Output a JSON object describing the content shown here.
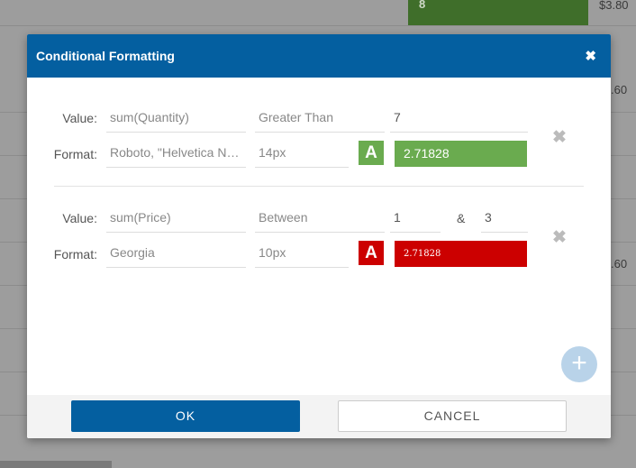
{
  "background": {
    "cell_value": "8",
    "price_1": "$3.80",
    "price_2": ".60",
    "price_3": ".60",
    "accent": "#3f6e2a"
  },
  "dialog": {
    "title": "Conditional Formatting",
    "close_icon": "close-icon",
    "header_color": "#045fa0"
  },
  "rules": [
    {
      "value_label": "Value:",
      "format_label": "Format:",
      "expression": "sum(Quantity)",
      "operator": "Greater Than",
      "value1": "7",
      "font": "Roboto, \"Helvetica Neue\", Helvetica, Arial, sans-serif",
      "size": "14px",
      "a_icon": "A",
      "preview_text": "2.71828",
      "color": "#6aab4f"
    },
    {
      "value_label": "Value:",
      "format_label": "Format:",
      "expression": "sum(Price)",
      "operator": "Between",
      "value1": "1",
      "amp": "&",
      "value2": "3",
      "font": "Georgia",
      "size": "10px",
      "a_icon": "A",
      "preview_text": "2.71828",
      "color": "#cc0000"
    }
  ],
  "add_icon": "+",
  "remove_icon": "✖",
  "footer": {
    "ok_label": "OK",
    "cancel_label": "CANCEL"
  }
}
